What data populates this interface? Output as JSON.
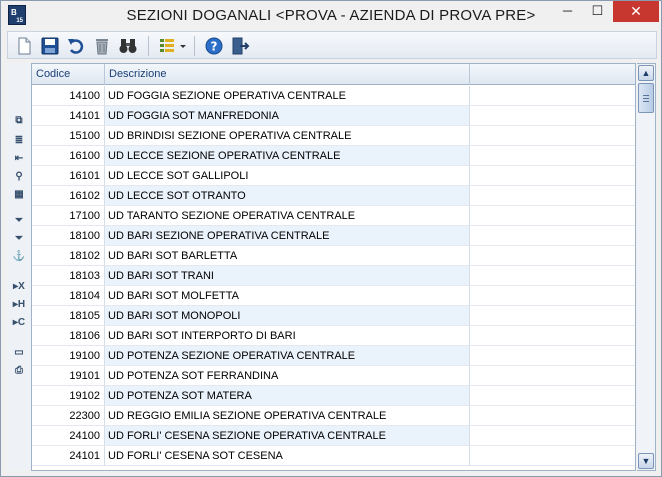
{
  "window": {
    "title": "SEZIONI DOGANALI <PROVA - AZIENDA DI PROVA PRE>",
    "app_icon_text": "B",
    "app_icon_sub": "15",
    "minimize": "─",
    "maximize": "☐",
    "close": "✕"
  },
  "toolbar": {
    "icons": [
      "new-document-icon",
      "save-icon",
      "undo-icon",
      "delete-icon",
      "binoculars-search-icon",
      "list-view-icon",
      "help-icon",
      "exit-icon"
    ]
  },
  "left_icons": [
    "copy-icon",
    "list-icon",
    "import-icon",
    "zoom-icon",
    "calculator-icon",
    "filter-icon",
    "filter-clear-icon",
    "anchor-icon",
    "export-excel-icon",
    "export-html-icon",
    "export-csv-icon",
    "monitor-icon",
    "print-icon"
  ],
  "grid": {
    "columns": [
      "Codice",
      "Descrizione"
    ],
    "rows": [
      {
        "code": "14100",
        "desc": "UD FOGGIA SEZIONE OPERATIVA CENTRALE"
      },
      {
        "code": "14101",
        "desc": "UD FOGGIA SOT MANFREDONIA"
      },
      {
        "code": "15100",
        "desc": "UD BRINDISI SEZIONE OPERATIVA CENTRALE"
      },
      {
        "code": "16100",
        "desc": "UD LECCE SEZIONE OPERATIVA CENTRALE"
      },
      {
        "code": "16101",
        "desc": "UD LECCE SOT GALLIPOLI"
      },
      {
        "code": "16102",
        "desc": "UD LECCE SOT OTRANTO"
      },
      {
        "code": "17100",
        "desc": "UD TARANTO SEZIONE OPERATIVA CENTRALE"
      },
      {
        "code": "18100",
        "desc": "UD BARI SEZIONE OPERATIVA CENTRALE"
      },
      {
        "code": "18102",
        "desc": "UD BARI SOT BARLETTA"
      },
      {
        "code": "18103",
        "desc": "UD BARI SOT TRANI"
      },
      {
        "code": "18104",
        "desc": "UD BARI SOT MOLFETTA"
      },
      {
        "code": "18105",
        "desc": "UD BARI SOT MONOPOLI"
      },
      {
        "code": "18106",
        "desc": "UD BARI SOT INTERPORTO DI BARI"
      },
      {
        "code": "19100",
        "desc": "UD POTENZA SEZIONE OPERATIVA CENTRALE"
      },
      {
        "code": "19101",
        "desc": "UD POTENZA SOT FERRANDINA"
      },
      {
        "code": "19102",
        "desc": "UD POTENZA SOT MATERA"
      },
      {
        "code": "22300",
        "desc": "UD REGGIO EMILIA SEZIONE OPERATIVA CENTRALE"
      },
      {
        "code": "24100",
        "desc": "UD FORLI' CESENA SEZIONE OPERATIVA CENTRALE"
      },
      {
        "code": "24101",
        "desc": "UD FORLI' CESENA SOT CESENA"
      }
    ]
  },
  "colors": {
    "header_text": "#1a3f78",
    "alt_row": "#eaf2fc",
    "close_button": "#c7372f"
  }
}
